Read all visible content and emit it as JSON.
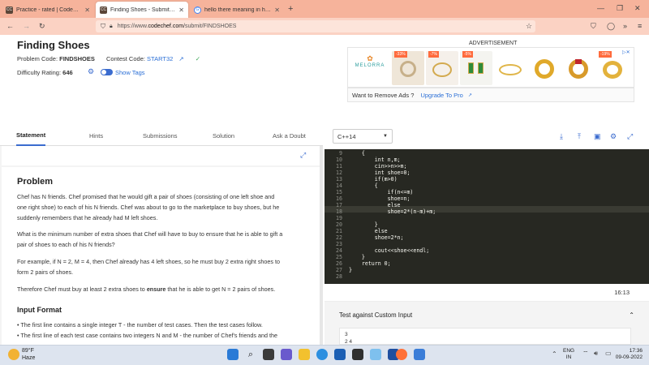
{
  "browser": {
    "tabs": [
      {
        "label": "Practice - rated | CodeChef",
        "favicon": "CC"
      },
      {
        "label": "Finding Shoes - Submit | CodeChef",
        "favicon": "CC"
      },
      {
        "label": "hello there meaning in hindi - G",
        "favicon": "G"
      }
    ],
    "url_prefix": "https://www.",
    "url_host": "codechef.com",
    "url_path": "/submit/FINDSHOES"
  },
  "problem": {
    "title": "Finding Shoes",
    "code_label": "Problem Code:",
    "code": "FINDSHOES",
    "contest_label": "Contest Code:",
    "contest": "START32",
    "difficulty_label": "Difficulty Rating:",
    "difficulty": "646",
    "show_tags": "Show Tags"
  },
  "ad": {
    "label": "ADVERTISEMENT",
    "brand": "MELORRA",
    "discounts": [
      "-33%",
      "-7%",
      "-5%",
      "-19%"
    ],
    "remove_text": "Want to Remove Ads ?",
    "upgrade": "Upgrade To Pro"
  },
  "left_tabs": [
    "Statement",
    "Hints",
    "Submissions",
    "Solution",
    "Ask a Doubt"
  ],
  "statement": {
    "heading": "Problem",
    "p1": [
      "Chef has N friends. Chef promised that he would gift a pair of shoes (consisting of one left shoe and",
      "one right shoe) to each of his N friends. Chef was about to go to the marketplace to buy shoes, but he",
      "suddenly remembers that he already had M left shoes."
    ],
    "p2": [
      "What is the minimum number of extra shoes that Chef will have to buy to ensure that he is able to gift a",
      "pair of shoes to each of his N friends?"
    ],
    "p3": [
      "For example, if N = 2, M = 4, then Chef already has 4 left shoes, so he must buy 2 extra right shoes to",
      "form 2 pairs of shoes."
    ],
    "p4_pre": "Therefore Chef must buy at least 2 extra shoes to ",
    "p4_bold": "ensure",
    "p4_post": " that he is able to get N = 2 pairs of shoes.",
    "input_heading": "Input Format",
    "bullets": [
      "The first line contains a single integer T - the number of test cases. Then the test cases follow.",
      "The first line of each test case contains two integers N and M - the number of Chef's friends and the"
    ]
  },
  "editor": {
    "language": "C++14",
    "line_numbers": [
      "9",
      "10",
      "11",
      "12",
      "13",
      "14",
      "15",
      "16",
      "17",
      "18",
      "19",
      "20",
      "21",
      "22",
      "23",
      "24",
      "25",
      "26",
      "27",
      "28"
    ],
    "lines": [
      "    {",
      "        int n,m;",
      "        cin>>n>>m;",
      "        int shoe=0;",
      "        if(m>0)",
      "        {",
      "            if(n<=m)",
      "            shoe=n;",
      "            else",
      "            shoe=2*(n-m)+m;",
      "",
      "        }",
      "        else",
      "        shoe=2*n;",
      "",
      "        cout<<shoe<<endl;",
      "    }",
      "    return 0;",
      "}",
      ""
    ],
    "cursor": "16:13"
  },
  "custom": {
    "title": "Test against Custom Input",
    "input_lines": [
      "3",
      "2 4"
    ]
  },
  "taskbar": {
    "temp": "89°F",
    "weather": "Haze",
    "lang": "ENG",
    "region": "IN",
    "time": "17:36",
    "date": "09-09-2022"
  }
}
